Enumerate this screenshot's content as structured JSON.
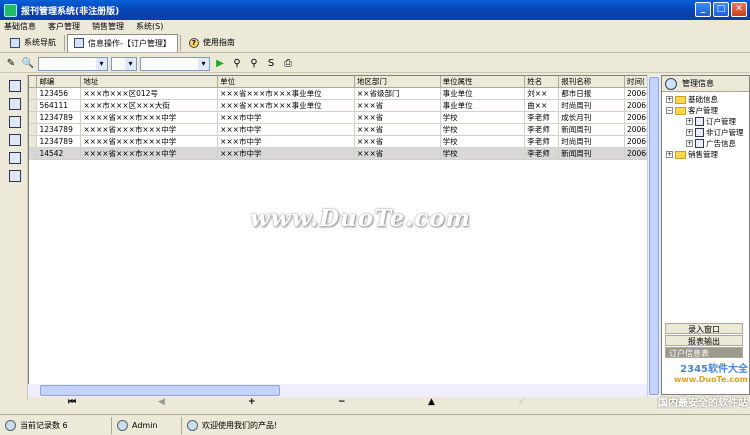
{
  "window": {
    "title": "报刊管理系统(非注册版)",
    "buttons": [
      "_",
      "□",
      "✕"
    ]
  },
  "menu": [
    "基础信息",
    "客户管理",
    "销售管理",
    "系统(S)"
  ],
  "tabs": [
    {
      "label": "系统导航"
    },
    {
      "label": "信息操作-【订户管理】"
    },
    {
      "label": "使用指南",
      "icon": "?"
    }
  ],
  "toolbar": {
    "combo1": "",
    "combo2": "",
    "combo3": ""
  },
  "grid": {
    "columns": [
      "邮编",
      "地址",
      "单位",
      "地区部门",
      "单位属性",
      "姓名",
      "报刊名称",
      "时间("
    ],
    "rows": [
      [
        "123456",
        "×××市×××区012号",
        "×××省×××市×××事业单位",
        "××省级部门",
        "事业单位",
        "刘××",
        "都市日报",
        "2006("
      ],
      [
        "564111",
        "×××市×××区×××大街",
        "×××省×××市×××事业单位",
        "×××省",
        "事业单位",
        "曲××",
        "时尚周刊",
        "2006("
      ],
      [
        "1234789",
        "××××省×××市×××中学",
        "×××市中学",
        "×××省",
        "学校",
        "李老师",
        "成长月刊",
        "2006("
      ],
      [
        "1234789",
        "××××省×××市×××中学",
        "×××市中学",
        "×××省",
        "学校",
        "李老师",
        "新闻周刊",
        "2006("
      ],
      [
        "1234789",
        "××××省×××市×××中学",
        "×××市中学",
        "×××省",
        "学校",
        "李老师",
        "时尚周刊",
        "2006("
      ],
      [
        "14542",
        "××××省×××市×××中学",
        "×××市中学",
        "×××省",
        "学校",
        "李老师",
        "新闻周刊",
        "2006("
      ]
    ]
  },
  "watermark": "www.DuoTe.com",
  "navigator": [
    "⏮",
    "◀",
    "+",
    "−",
    "▲",
    "✓"
  ],
  "tree": {
    "title": "管理信息",
    "nodes": [
      "基础信息",
      "客户管理",
      "订户管理",
      "非订户管理",
      "广告信息",
      "销售管理"
    ]
  },
  "panel_buttons": [
    "录入窗口",
    "报表输出",
    "订户信息表"
  ],
  "status": {
    "record_count": "当前记录数 6",
    "user": "Admin",
    "welcome": "欢迎使用我们的产品!"
  },
  "corner": {
    "site": "2345软件大全",
    "url": "www.DuoTe.com",
    "tag": "国内最安全的软件站"
  }
}
